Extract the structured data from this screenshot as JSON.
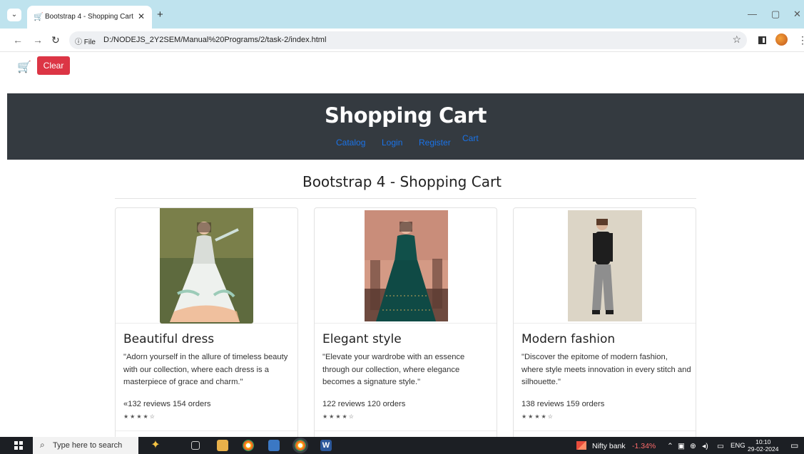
{
  "browser": {
    "tab_title": "Bootstrap 4 - Shopping Cart",
    "site_info": "File",
    "url": "D:/NODEJS_2Y2SEM/Manual%20Programs/2/task-2/index.html"
  },
  "topbar": {
    "clear_label": "Clear"
  },
  "header": {
    "title": "Shopping Cart",
    "nav": [
      "Catalog",
      "Login",
      "Register",
      "Cart"
    ]
  },
  "main": {
    "title": "Bootstrap 4 - Shopping Cart",
    "products": [
      {
        "title": "Beautiful dress",
        "description": "\"Adorn yourself in the allure of timeless beauty with our collection, where each dress is a masterpiece of grace and charm.\"",
        "meta": "«132 reviews   154 orders",
        "stars": "★★★★☆",
        "rating": 4
      },
      {
        "title": "Elegant style",
        "description": "\"Elevate your wardrobe with an essence through our collection, where elegance becomes a signature style.\"",
        "meta": "122 reviews   120 orders",
        "stars": "★★★★☆",
        "rating": 4
      },
      {
        "title": "Modern fashion",
        "description": "\"Discover the epitome of modern fashion, where style meets innovation in every stitch and silhouette.\"",
        "meta": "138 reviews   159 orders",
        "stars": "★★★★☆",
        "rating": 4
      }
    ]
  },
  "taskbar": {
    "search_placeholder": "Type here to search",
    "nifty_label": "Nifty bank",
    "nifty_change": "-1.34%",
    "language": "ENG",
    "time": "10:10",
    "date": "29-02-2024"
  },
  "colors": {
    "header_bg": "#343a40",
    "clear_button": "#dc3545",
    "nav_link": "#1a73e8",
    "nifty_negative": "#ff6b6b"
  }
}
